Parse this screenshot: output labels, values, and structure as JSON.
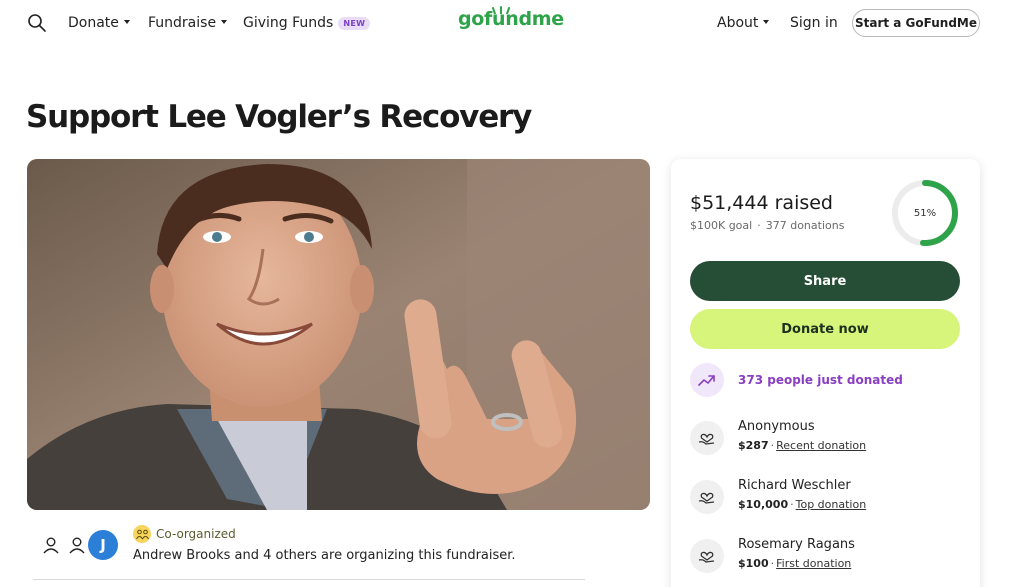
{
  "header": {
    "nav_left": [
      {
        "label": "Donate",
        "has_caret": true
      },
      {
        "label": "Fundraise",
        "has_caret": true
      },
      {
        "label": "Giving Funds",
        "badge": "NEW"
      }
    ],
    "logo_text": "gofundme",
    "nav_right": [
      {
        "label": "About",
        "has_caret": true
      },
      {
        "label": "Sign in"
      }
    ],
    "start_button": "Start a GoFundMe",
    "icons": {
      "search": "search-icon",
      "caret": "chevron-down-icon"
    }
  },
  "page": {
    "title": "Support Lee Vogler’s Recovery",
    "hero_image_icon": "fundraiser-photo"
  },
  "organizers": {
    "badge_label": "Co-organized",
    "avatar_letter": "J",
    "text": "Andrew Brooks and 4 others are organizing this fundraiser.",
    "colors": {
      "avatar_j": "#2b7fd6",
      "badge_bg": "#f7d45c"
    }
  },
  "donation_card": {
    "raised": "$51,444 raised",
    "goal": "$100K goal",
    "donations_count": "377 donations",
    "separator": "·",
    "progress_label": "51%",
    "progress_fraction": 0.51,
    "share_label": "Share",
    "donate_label": "Donate now",
    "trend_text": "373 people just donated",
    "recent": [
      {
        "name": "Anonymous",
        "amount": "$287",
        "sep": "·",
        "tag": "Recent donation"
      },
      {
        "name": "Richard Weschler",
        "amount": "$10,000",
        "sep": "·",
        "tag": "Top donation"
      },
      {
        "name": "Rosemary Ragans",
        "amount": "$100",
        "sep": "·",
        "tag": "First donation"
      }
    ],
    "colors": {
      "share_bg": "#264d35",
      "donate_bg": "#d6f57a",
      "progress": "#2fa34a",
      "trend_text": "#8a3fc2",
      "brand_green": "#2fa34a"
    }
  }
}
